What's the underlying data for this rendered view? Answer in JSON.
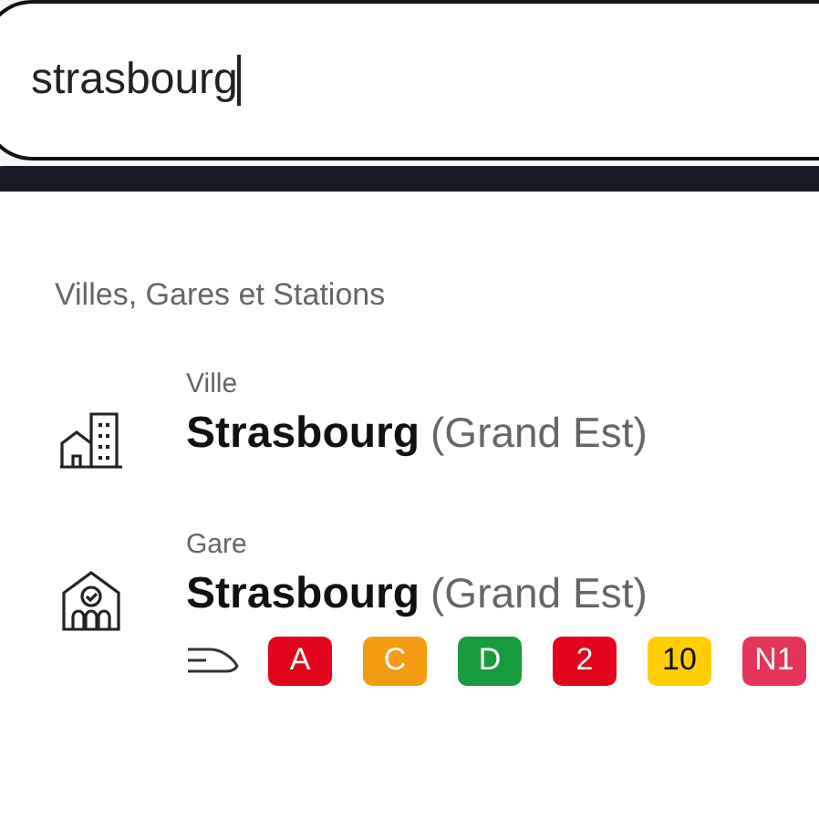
{
  "search": {
    "value": "strasbourg"
  },
  "section": {
    "title": "Villes, Gares et Stations"
  },
  "results": [
    {
      "kind": "city",
      "type_label": "Ville",
      "name": "Strasbourg",
      "region": "(Grand Est)"
    },
    {
      "kind": "station",
      "type_label": "Gare",
      "name": "Strasbourg",
      "region": "(Grand Est)",
      "lines": [
        {
          "label": "A",
          "color": "#e3051b"
        },
        {
          "label": "C",
          "color": "#f39c12"
        },
        {
          "label": "D",
          "color": "#179b3d"
        },
        {
          "label": "2",
          "color": "#e3051b"
        },
        {
          "label": "10",
          "color": "#ffcd00"
        },
        {
          "label": "N1",
          "color": "#e6335a"
        }
      ]
    }
  ]
}
